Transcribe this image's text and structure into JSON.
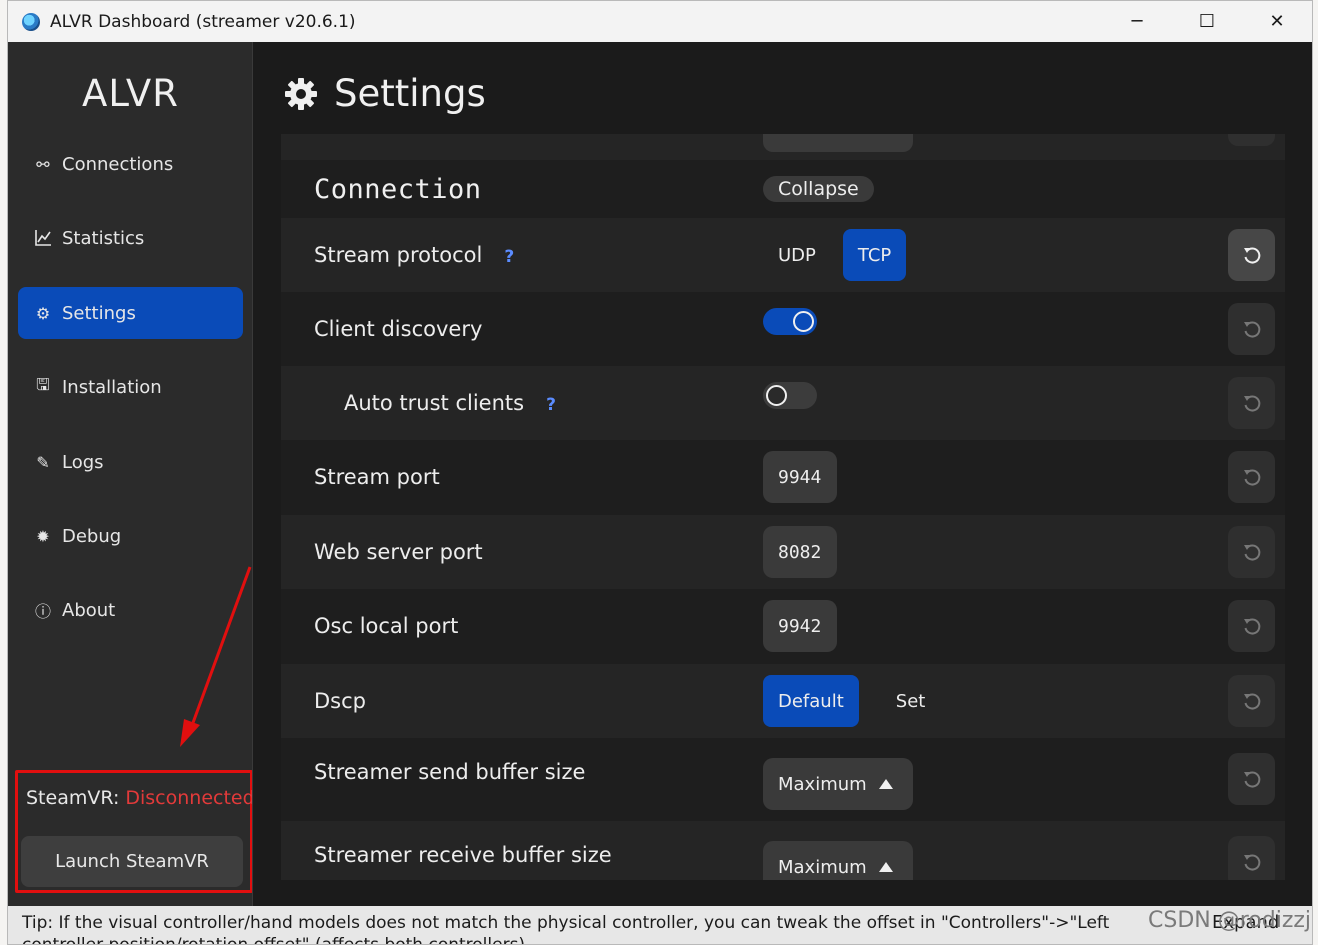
{
  "window": {
    "title": "ALVR Dashboard (streamer v20.6.1)",
    "controls": {
      "minimize": "─",
      "maximize": "☐",
      "close": "✕"
    }
  },
  "sidebar": {
    "brand": "ALVR",
    "items": [
      {
        "label": "Connections",
        "icon": "connections-icon",
        "glyph": "⚯"
      },
      {
        "label": "Statistics",
        "icon": "statistics-icon",
        "glyph": "📈"
      },
      {
        "label": "Settings",
        "icon": "settings-icon",
        "glyph": "⚙"
      },
      {
        "label": "Installation",
        "icon": "installation-icon",
        "glyph": "🖫"
      },
      {
        "label": "Logs",
        "icon": "logs-icon",
        "glyph": "✎"
      },
      {
        "label": "Debug",
        "icon": "debug-icon",
        "glyph": "✹"
      },
      {
        "label": "About",
        "icon": "about-icon",
        "glyph": "ⓘ"
      }
    ],
    "active_item": "Settings",
    "steamvr_label": "SteamVR:",
    "steamvr_state": "Disconnected",
    "launch_button": "Launch SteamVR"
  },
  "header": {
    "title": "Settings"
  },
  "settings": {
    "section_title": "Connection",
    "collapse_label": "Collapse",
    "help_glyph": "?",
    "stream_protocol": {
      "label": "Stream protocol",
      "options": [
        "UDP",
        "TCP"
      ],
      "selected": "TCP"
    },
    "client_discovery": {
      "label": "Client discovery",
      "enabled": true
    },
    "auto_trust_clients": {
      "label": "Auto trust clients",
      "enabled": false
    },
    "stream_port": {
      "label": "Stream port",
      "value": "9944"
    },
    "web_server_port": {
      "label": "Web server port",
      "value": "8082"
    },
    "osc_local_port": {
      "label": "Osc local port",
      "value": "9942"
    },
    "dscp": {
      "label": "Dscp",
      "options": [
        "Default",
        "Set"
      ],
      "selected": "Default"
    },
    "send_buffer": {
      "label": "Streamer send buffer size",
      "value": "Maximum"
    },
    "receive_buffer": {
      "label": "Streamer receive buffer size",
      "value": "Maximum"
    }
  },
  "footer": {
    "tip": "Tip: If the visual controller/hand models does not match the physical controller, you can tweak the offset in \"Controllers\"->\"Left controller position/rotation offset\" (affects both controllers).",
    "expand": "Expand",
    "watermark": "CSDN @rodizzj"
  },
  "colors": {
    "accent": "#0a4bb8",
    "error": "#e23a3a",
    "annotation": "#e10f0f"
  }
}
